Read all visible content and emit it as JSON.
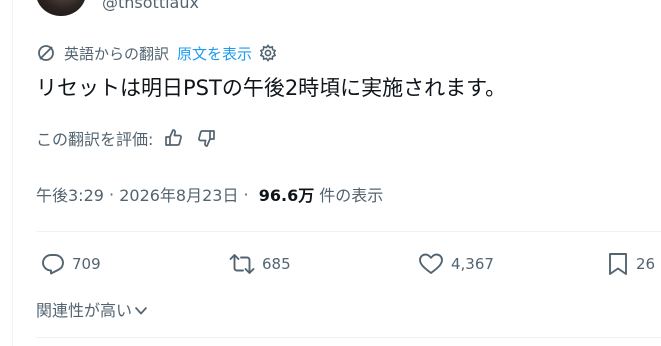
{
  "author": {
    "handle": "@thsottiaux"
  },
  "translation": {
    "label": "英語からの翻訳",
    "show_original": "原文を表示"
  },
  "tweet": {
    "text": "リセットは明日PSTの午後2時頃に実施されます。"
  },
  "rating": {
    "label": "この翻訳を評価:"
  },
  "meta": {
    "time": "午後3:29",
    "separator1": " · ",
    "date": "2026年8月23日",
    "separator2": " · ",
    "views_count": "96.6万",
    "views_label": "件の表示"
  },
  "actions": {
    "replies": "709",
    "reposts": "685",
    "likes": "4,367",
    "bookmarks": "26"
  },
  "relevance": {
    "label": "関連性が高い"
  },
  "colors": {
    "link": "#1d9bf0",
    "muted": "#536471",
    "text": "#0f1419"
  }
}
